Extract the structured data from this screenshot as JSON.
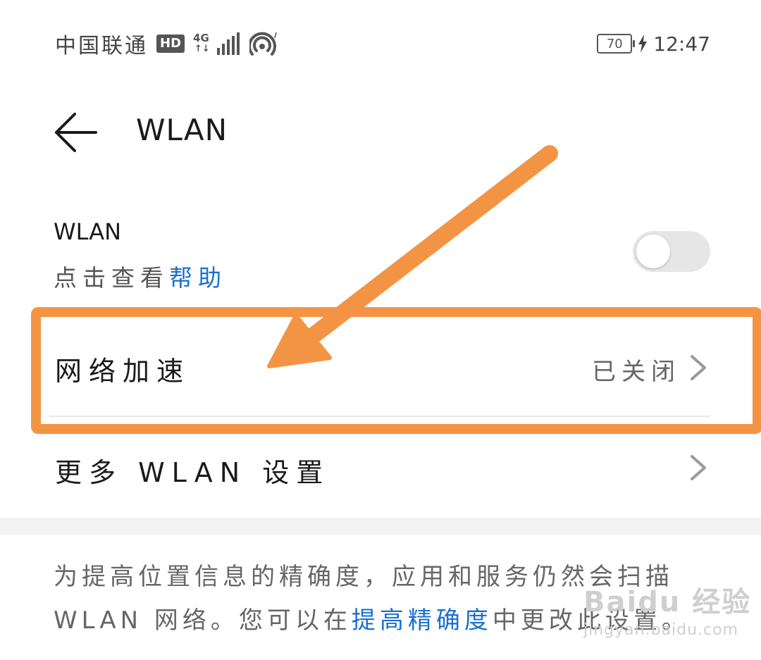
{
  "status_bar": {
    "carrier": "中国联通",
    "hd_badge": "HD",
    "network_top": "4G",
    "network_bottom": "↑↓",
    "battery_level": "70",
    "time": "12:47"
  },
  "header": {
    "back_icon": "arrow-left-icon",
    "title": "WLAN"
  },
  "wlan_toggle": {
    "label": "WLAN",
    "hint_prefix": "点击查看",
    "hint_link": "帮助",
    "state": "off"
  },
  "rows": [
    {
      "label": "网络加速",
      "value": "已关闭",
      "icon": "chevron-right-icon"
    },
    {
      "label": "更多 WLAN 设置",
      "value": "",
      "icon": "chevron-right-icon"
    }
  ],
  "footer": {
    "line1": "为提高位置信息的精确度，应用和服务仍然会扫描",
    "line2_prefix": "WLAN 网络。您可以在",
    "line2_link": "提高精确度",
    "line2_suffix": "中更改此设置。"
  },
  "watermark": {
    "brand": "Baidu 经验",
    "url": "jingyan.baidu.com"
  },
  "colors": {
    "annotation_orange": "#f39445",
    "link_blue": "#1a6fcf",
    "toggle_off_track": "#e6e6e6"
  }
}
